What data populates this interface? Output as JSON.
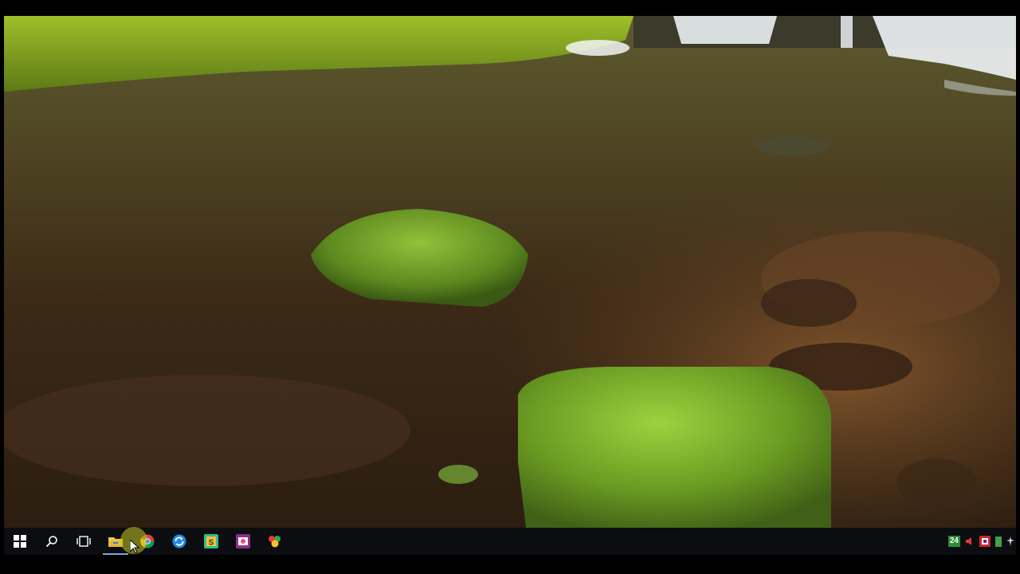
{
  "desktop": {
    "wallpaper_icon": "nature-landscape"
  },
  "taskbar": {
    "buttons": [
      {
        "icon": "windows-start-icon"
      },
      {
        "icon": "search-icon"
      },
      {
        "icon": "task-view-icon"
      },
      {
        "icon": "file-explorer-icon"
      },
      {
        "icon": "chrome-icon"
      },
      {
        "icon": "sync-app-icon"
      },
      {
        "icon": "snagit-app-icon"
      },
      {
        "icon": "media-app-icon"
      },
      {
        "icon": "colorful-app-icon"
      }
    ],
    "tray": {
      "badge_text": "24",
      "icons": [
        "volume-icon",
        "network-icon",
        "battery-icon",
        "settings-icon"
      ]
    }
  },
  "colors": {
    "taskbar_bg": "#0b0d10",
    "accent": "#7aa7d9"
  }
}
